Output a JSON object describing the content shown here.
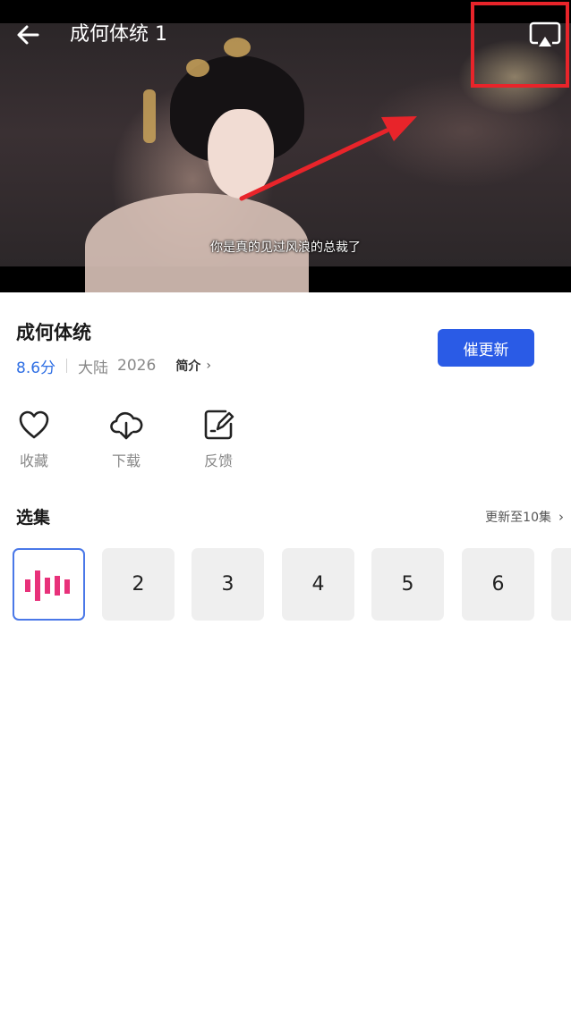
{
  "player": {
    "title": "成何体统 1",
    "subtitle": "你是真的见过风浪的总裁了",
    "icons": {
      "back": "arrow-left-icon",
      "cast": "screen-cast-icon"
    }
  },
  "show": {
    "title": "成何体统",
    "rating": "8.6分",
    "region": "大陆",
    "year": "2026",
    "intro_label": "简介",
    "update_button": "催更新"
  },
  "actions": [
    {
      "label": "收藏",
      "icon": "heart-icon"
    },
    {
      "label": "下载",
      "icon": "cloud-download-icon"
    },
    {
      "label": "反馈",
      "icon": "feedback-edit-icon"
    }
  ],
  "episodes": {
    "heading": "选集",
    "more_label": "更新至10集",
    "items": [
      "2",
      "3",
      "4",
      "5",
      "6"
    ],
    "playing_icon": "now-playing-bars-icon"
  },
  "colors": {
    "accent": "#2a5be6",
    "rating": "#2f6fe4",
    "playing_bars": "#e8317a",
    "annotation": "#e8242a"
  }
}
